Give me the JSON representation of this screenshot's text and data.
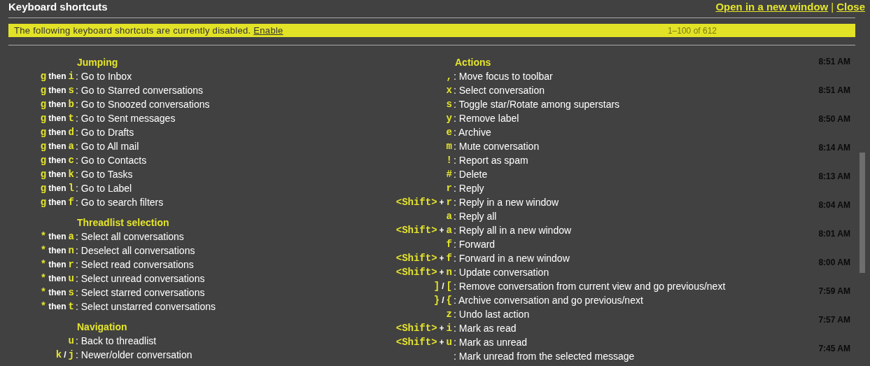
{
  "title": "Keyboard shortcuts",
  "links": [
    "Open in a new window",
    "|",
    "Close"
  ],
  "banner": {
    "text": "The following keyboard shortcuts are currently disabled.",
    "link": "Enable",
    "page_range": "1–100 of 612"
  },
  "background_times": [
    "8:51 AM",
    "8:51 AM",
    "8:50 AM",
    "8:14 AM",
    "8:13 AM",
    "8:04 AM",
    "8:01 AM",
    "8:00 AM",
    "7:59 AM",
    "7:57 AM",
    "7:45 AM"
  ],
  "columns": [
    {
      "sections": [
        {
          "title": "Jumping",
          "shortcuts": [
            {
              "keys": [
                {
                  "kind": "key",
                  "text": "g"
                },
                {
                  "kind": "word",
                  "text": "then"
                },
                {
                  "kind": "key",
                  "text": "i"
                }
              ],
              "action": ": Go to Inbox"
            },
            {
              "keys": [
                {
                  "kind": "key",
                  "text": "g"
                },
                {
                  "kind": "word",
                  "text": "then"
                },
                {
                  "kind": "key",
                  "text": "s"
                }
              ],
              "action": ": Go to Starred conversations"
            },
            {
              "keys": [
                {
                  "kind": "key",
                  "text": "g"
                },
                {
                  "kind": "word",
                  "text": "then"
                },
                {
                  "kind": "key",
                  "text": "b"
                }
              ],
              "action": ": Go to Snoozed conversations"
            },
            {
              "keys": [
                {
                  "kind": "key",
                  "text": "g"
                },
                {
                  "kind": "word",
                  "text": "then"
                },
                {
                  "kind": "key",
                  "text": "t"
                }
              ],
              "action": ": Go to Sent messages"
            },
            {
              "keys": [
                {
                  "kind": "key",
                  "text": "g"
                },
                {
                  "kind": "word",
                  "text": "then"
                },
                {
                  "kind": "key",
                  "text": "d"
                }
              ],
              "action": ": Go to Drafts"
            },
            {
              "keys": [
                {
                  "kind": "key",
                  "text": "g"
                },
                {
                  "kind": "word",
                  "text": "then"
                },
                {
                  "kind": "key",
                  "text": "a"
                }
              ],
              "action": ": Go to All mail"
            },
            {
              "keys": [
                {
                  "kind": "key",
                  "text": "g"
                },
                {
                  "kind": "word",
                  "text": "then"
                },
                {
                  "kind": "key",
                  "text": "c"
                }
              ],
              "action": ": Go to Contacts"
            },
            {
              "keys": [
                {
                  "kind": "key",
                  "text": "g"
                },
                {
                  "kind": "word",
                  "text": "then"
                },
                {
                  "kind": "key",
                  "text": "k"
                }
              ],
              "action": ": Go to Tasks"
            },
            {
              "keys": [
                {
                  "kind": "key",
                  "text": "g"
                },
                {
                  "kind": "word",
                  "text": "then"
                },
                {
                  "kind": "key",
                  "text": "l"
                }
              ],
              "action": ": Go to Label"
            },
            {
              "keys": [
                {
                  "kind": "key",
                  "text": "g"
                },
                {
                  "kind": "word",
                  "text": "then"
                },
                {
                  "kind": "key",
                  "text": "f"
                }
              ],
              "action": ": Go to search filters"
            }
          ]
        },
        {
          "title": "Threadlist selection",
          "shortcuts": [
            {
              "keys": [
                {
                  "kind": "key",
                  "text": "*"
                },
                {
                  "kind": "word",
                  "text": "then"
                },
                {
                  "kind": "key",
                  "text": "a"
                }
              ],
              "action": ": Select all conversations"
            },
            {
              "keys": [
                {
                  "kind": "key",
                  "text": "*"
                },
                {
                  "kind": "word",
                  "text": "then"
                },
                {
                  "kind": "key",
                  "text": "n"
                }
              ],
              "action": ": Deselect all conversations"
            },
            {
              "keys": [
                {
                  "kind": "key",
                  "text": "*"
                },
                {
                  "kind": "word",
                  "text": "then"
                },
                {
                  "kind": "key",
                  "text": "r"
                }
              ],
              "action": ": Select read conversations"
            },
            {
              "keys": [
                {
                  "kind": "key",
                  "text": "*"
                },
                {
                  "kind": "word",
                  "text": "then"
                },
                {
                  "kind": "key",
                  "text": "u"
                }
              ],
              "action": ": Select unread conversations"
            },
            {
              "keys": [
                {
                  "kind": "key",
                  "text": "*"
                },
                {
                  "kind": "word",
                  "text": "then"
                },
                {
                  "kind": "key",
                  "text": "s"
                }
              ],
              "action": ": Select starred conversations"
            },
            {
              "keys": [
                {
                  "kind": "key",
                  "text": "*"
                },
                {
                  "kind": "word",
                  "text": "then"
                },
                {
                  "kind": "key",
                  "text": "t"
                }
              ],
              "action": ": Select unstarred conversations"
            }
          ]
        },
        {
          "title": "Navigation",
          "shortcuts": [
            {
              "keys": [
                {
                  "kind": "key",
                  "text": "u"
                }
              ],
              "action": ": Back to threadlist"
            },
            {
              "keys": [
                {
                  "kind": "key",
                  "text": "k"
                },
                {
                  "kind": "word",
                  "text": "/"
                },
                {
                  "kind": "key",
                  "text": "j"
                }
              ],
              "action": ": Newer/older conversation"
            }
          ]
        }
      ]
    },
    {
      "sections": [
        {
          "title": "Actions",
          "shortcuts": [
            {
              "keys": [
                {
                  "kind": "key",
                  "text": ","
                }
              ],
              "action": ": Move focus to toolbar"
            },
            {
              "keys": [
                {
                  "kind": "key",
                  "text": "x"
                }
              ],
              "action": ": Select conversation"
            },
            {
              "keys": [
                {
                  "kind": "key",
                  "text": "s"
                }
              ],
              "action": ": Toggle star/Rotate among superstars"
            },
            {
              "keys": [
                {
                  "kind": "key",
                  "text": "y"
                }
              ],
              "action": ": Remove label"
            },
            {
              "keys": [
                {
                  "kind": "key",
                  "text": "e"
                }
              ],
              "action": ": Archive"
            },
            {
              "keys": [
                {
                  "kind": "key",
                  "text": "m"
                }
              ],
              "action": ": Mute conversation"
            },
            {
              "keys": [
                {
                  "kind": "key",
                  "text": "!"
                }
              ],
              "action": ": Report as spam"
            },
            {
              "keys": [
                {
                  "kind": "key",
                  "text": "#"
                }
              ],
              "action": ": Delete"
            },
            {
              "keys": [
                {
                  "kind": "key",
                  "text": "r"
                }
              ],
              "action": ": Reply"
            },
            {
              "keys": [
                {
                  "kind": "key",
                  "text": "<Shift>"
                },
                {
                  "kind": "word",
                  "text": "+"
                },
                {
                  "kind": "key",
                  "text": "r"
                }
              ],
              "action": ": Reply in a new window"
            },
            {
              "keys": [
                {
                  "kind": "key",
                  "text": "a"
                }
              ],
              "action": ": Reply all"
            },
            {
              "keys": [
                {
                  "kind": "key",
                  "text": "<Shift>"
                },
                {
                  "kind": "word",
                  "text": "+"
                },
                {
                  "kind": "key",
                  "text": "a"
                }
              ],
              "action": ": Reply all in a new window"
            },
            {
              "keys": [
                {
                  "kind": "key",
                  "text": "f"
                }
              ],
              "action": ": Forward"
            },
            {
              "keys": [
                {
                  "kind": "key",
                  "text": "<Shift>"
                },
                {
                  "kind": "word",
                  "text": "+"
                },
                {
                  "kind": "key",
                  "text": "f"
                }
              ],
              "action": ": Forward in a new window"
            },
            {
              "keys": [
                {
                  "kind": "key",
                  "text": "<Shift>"
                },
                {
                  "kind": "word",
                  "text": "+"
                },
                {
                  "kind": "key",
                  "text": "n"
                }
              ],
              "action": ": Update conversation"
            },
            {
              "keys": [
                {
                  "kind": "key",
                  "text": "]"
                },
                {
                  "kind": "word",
                  "text": "/"
                },
                {
                  "kind": "key",
                  "text": "["
                }
              ],
              "action": ": Remove conversation from current view and go previous/next"
            },
            {
              "keys": [
                {
                  "kind": "key",
                  "text": "}"
                },
                {
                  "kind": "word",
                  "text": "/"
                },
                {
                  "kind": "key",
                  "text": "{"
                }
              ],
              "action": ": Archive conversation and go previous/next"
            },
            {
              "keys": [
                {
                  "kind": "key",
                  "text": "z"
                }
              ],
              "action": ": Undo last action"
            },
            {
              "keys": [
                {
                  "kind": "key",
                  "text": "<Shift>"
                },
                {
                  "kind": "word",
                  "text": "+"
                },
                {
                  "kind": "key",
                  "text": "i"
                }
              ],
              "action": ": Mark as read"
            },
            {
              "keys": [
                {
                  "kind": "key",
                  "text": "<Shift>"
                },
                {
                  "kind": "word",
                  "text": "+"
                },
                {
                  "kind": "key",
                  "text": "u"
                }
              ],
              "action": ": Mark as unread"
            },
            {
              "action": ": Mark unread from the selected message"
            }
          ]
        }
      ]
    }
  ]
}
